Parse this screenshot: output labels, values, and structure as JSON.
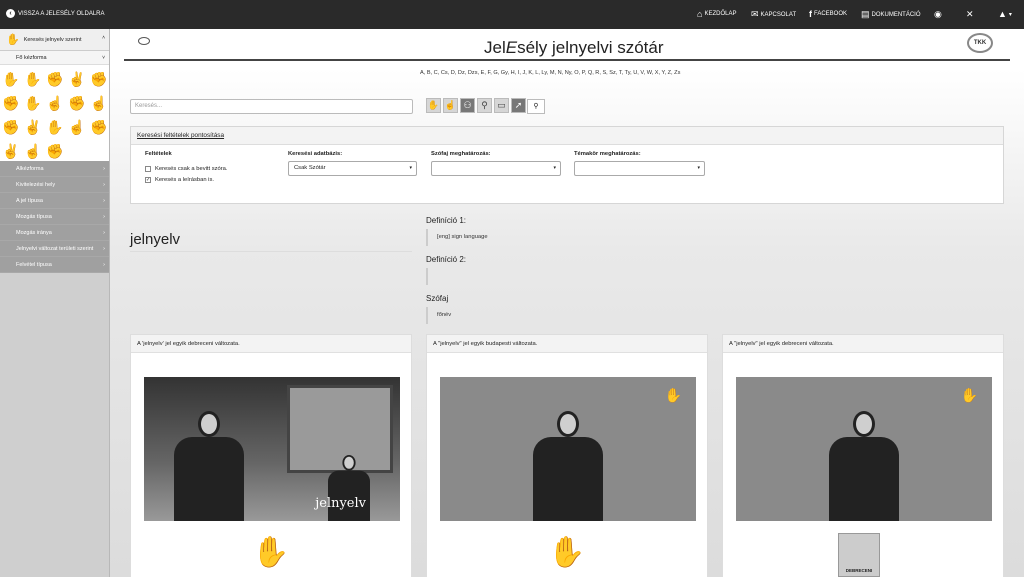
{
  "topbar": {
    "back_label": "VISSZA A JELESÉLY OLDALRA",
    "nav": [
      {
        "label": "KEZDŐLAP",
        "icon": "home-icon"
      },
      {
        "label": "KAPCSOLAT",
        "icon": "envelope-icon"
      },
      {
        "label": "FACEBOOK",
        "icon": "facebook-icon"
      },
      {
        "label": "DOKUMENTÁCIÓ",
        "icon": "document-icon"
      }
    ]
  },
  "sidebar": {
    "search_by": "Keresés jelnyelv szerint",
    "main_handform": "Fő kézforma",
    "items": [
      {
        "label": "Alkézforma"
      },
      {
        "label": "Kivitelezési hely"
      },
      {
        "label": "A jel típusa"
      },
      {
        "label": "Mozgás típusa"
      },
      {
        "label": "Mozgás iránya"
      },
      {
        "label": "Jelnyelvi változat területi szerint"
      },
      {
        "label": "Felvétel típusa"
      }
    ]
  },
  "header": {
    "title_pre": "Jel",
    "title_em": "E",
    "title_post": "sély jelnyelvi szótár",
    "right_logo": "TKK"
  },
  "alphabet": "A, B, C, Cs, D, Dz, Dzs, E, F, G, Gy, H, I, J, K, L, Ly, M, N, Ny, O, P, Q, R, S, Sz, T, Ty, U, V, W, X, Y, Z, Zs",
  "search": {
    "placeholder": "Keresés..."
  },
  "filter": {
    "title": "Keresési feltételek pontosítása",
    "conditions_label": "Feltételek",
    "check1": "Keresés csak a bevitt szóra.",
    "check2": "Keresés a leírásban is.",
    "db_label": "Keresési adatbázis:",
    "db_value": "Csak Szótár",
    "pos_label": "Szófaj meghatározás:",
    "topic_label": "Témakör meghatározás:"
  },
  "entry": {
    "word": "jelnyelv",
    "def1_label": "Definíció 1:",
    "def1_value": "[eng] sign language",
    "def2_label": "Definíció 2:",
    "pos_label": "Szófaj",
    "pos_value": "főnév"
  },
  "cards": [
    {
      "caption": "A 'jelnyelv' jel egyik debreceni változata.",
      "video_text": "jelnyelv"
    },
    {
      "caption": "A \"jelnyelv\" jel egyik budapesti változata."
    },
    {
      "caption": "A \"jelnyelv\" jel egyik debreceni változata.",
      "map_label": "DEBRECENI"
    }
  ]
}
